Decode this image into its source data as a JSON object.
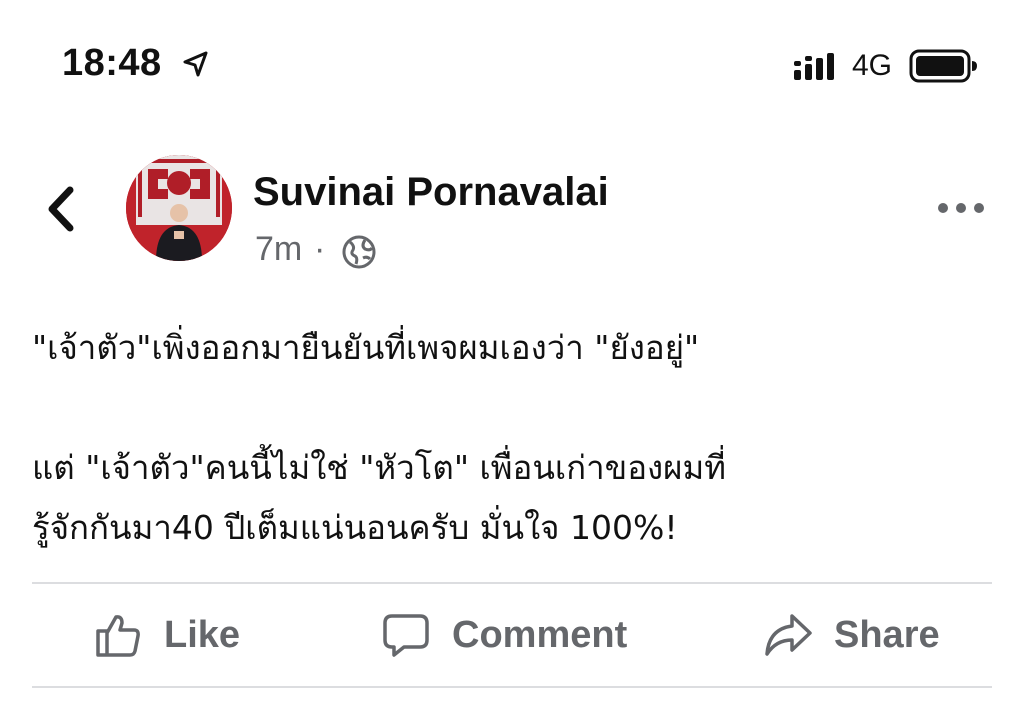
{
  "status_bar": {
    "time": "18:48",
    "network": "4G",
    "icons": [
      "location-arrow-icon",
      "signal-icon",
      "battery-icon"
    ]
  },
  "post": {
    "author": "Suvinai Pornavalai",
    "time_ago": "7m",
    "separator": "·",
    "audience_icon": "globe-icon",
    "lines": [
      "\"เจ้าตัว\"เพิ่งออกมายืนยันที่เพจผมเองว่า \"ยังอยู่\"",
      " แต่ \"เจ้าตัว\"คนนี้ไม่ใช่ \"หัวโต\" เพื่อนเก่าของผมที่",
      "รู้จักกันมา40 ปีเต็มแน่นอนครับ มั่นใจ 100%!"
    ]
  },
  "actions": {
    "like": "Like",
    "comment": "Comment",
    "share": "Share"
  },
  "colors": {
    "text": "#111111",
    "secondary": "#65676b",
    "divider": "#dcdde0",
    "avatar_bg": "#c0232b"
  }
}
